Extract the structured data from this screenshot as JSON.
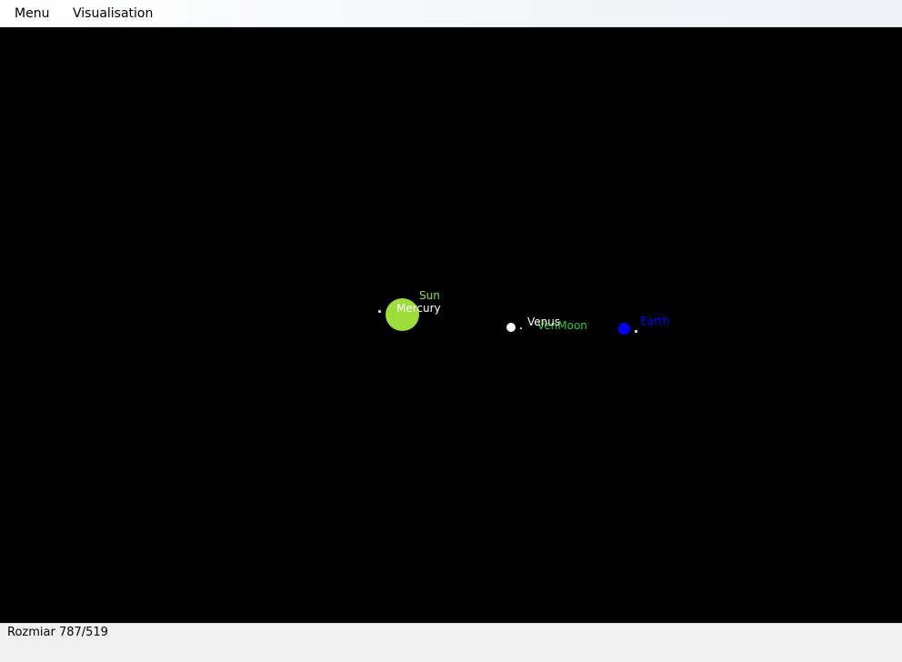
{
  "menubar": {
    "items": [
      "Menu",
      "Visualisation"
    ]
  },
  "bodies": {
    "sun": {
      "label": "Sun",
      "color": "#9ddd3a"
    },
    "mercury": {
      "label": "Mercury",
      "color": "#ffffff"
    },
    "venus": {
      "label": "Venus",
      "color": "#ffffff"
    },
    "venus_moon": {
      "label": "VenMoon",
      "color": "#32c832"
    },
    "earth": {
      "label": "Earth",
      "color": "#0000ff"
    }
  },
  "statusbar": {
    "text": "Rozmiar 787/519"
  }
}
